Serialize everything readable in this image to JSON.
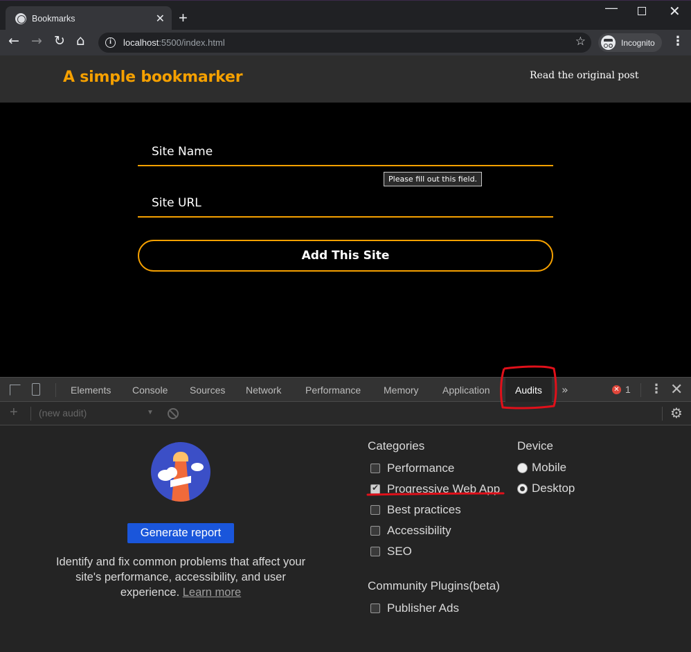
{
  "browser": {
    "tab_title": "Bookmarks",
    "new_tab": "+",
    "url_host": "localhost",
    "url_path": ":5500/index.html",
    "profile_label": "Incognito"
  },
  "page": {
    "title": "A simple bookmarker",
    "header_link": "Read the original post",
    "site_name_placeholder": "Site Name",
    "site_url_placeholder": "Site URL",
    "validation_tooltip": "Please fill out this field.",
    "add_button": "Add This Site",
    "accent_color": "#f5a000"
  },
  "devtools": {
    "tabs": [
      "Elements",
      "Console",
      "Sources",
      "Network",
      "Performance",
      "Memory",
      "Application",
      "Audits"
    ],
    "active_tab": "Audits",
    "more_tabs": "»",
    "error_count": "1",
    "audit_select_placeholder": "(new audit)",
    "audits": {
      "generate_button": "Generate report",
      "description": "Identify and fix common problems that affect your site's performance, accessibility, and user experience.",
      "learn_more": "Learn more",
      "categories_heading": "Categories",
      "categories": [
        {
          "label": "Performance",
          "checked": false
        },
        {
          "label": "Progressive Web App",
          "checked": true
        },
        {
          "label": "Best practices",
          "checked": false
        },
        {
          "label": "Accessibility",
          "checked": false
        },
        {
          "label": "SEO",
          "checked": false
        }
      ],
      "device_heading": "Device",
      "devices": [
        {
          "label": "Mobile",
          "selected": false
        },
        {
          "label": "Desktop",
          "selected": true
        }
      ],
      "plugins_heading": "Community Plugins(beta)",
      "plugins": [
        {
          "label": "Publisher Ads",
          "checked": false
        }
      ]
    }
  },
  "annotation_color": "#e0101a"
}
